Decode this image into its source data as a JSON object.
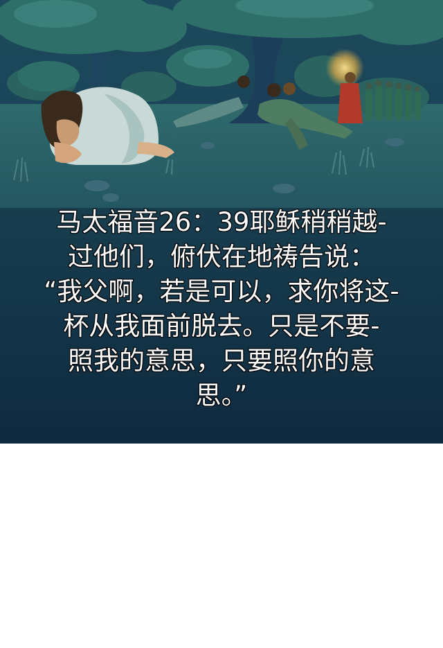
{
  "caption": {
    "lines": [
      "马太福音26：39耶稣稍稍越-",
      "过他们，俯伏在地祷告说：",
      "“我父啊，若是可以，求你将这-",
      "杯从我面前脱去。只是不要-",
      "照我的意思，只要照你的意",
      "思。”"
    ]
  },
  "colors": {
    "sky_top": "#1d4a5c",
    "ground_dark": "#0f2a40",
    "foliage": "#2f6f6a",
    "robe_light": "#c9d9d6",
    "torch_glow": "#e8c46a",
    "soldier_red": "#b23a2a",
    "caption_text": "#ffffff",
    "caption_outline": "#000000"
  }
}
